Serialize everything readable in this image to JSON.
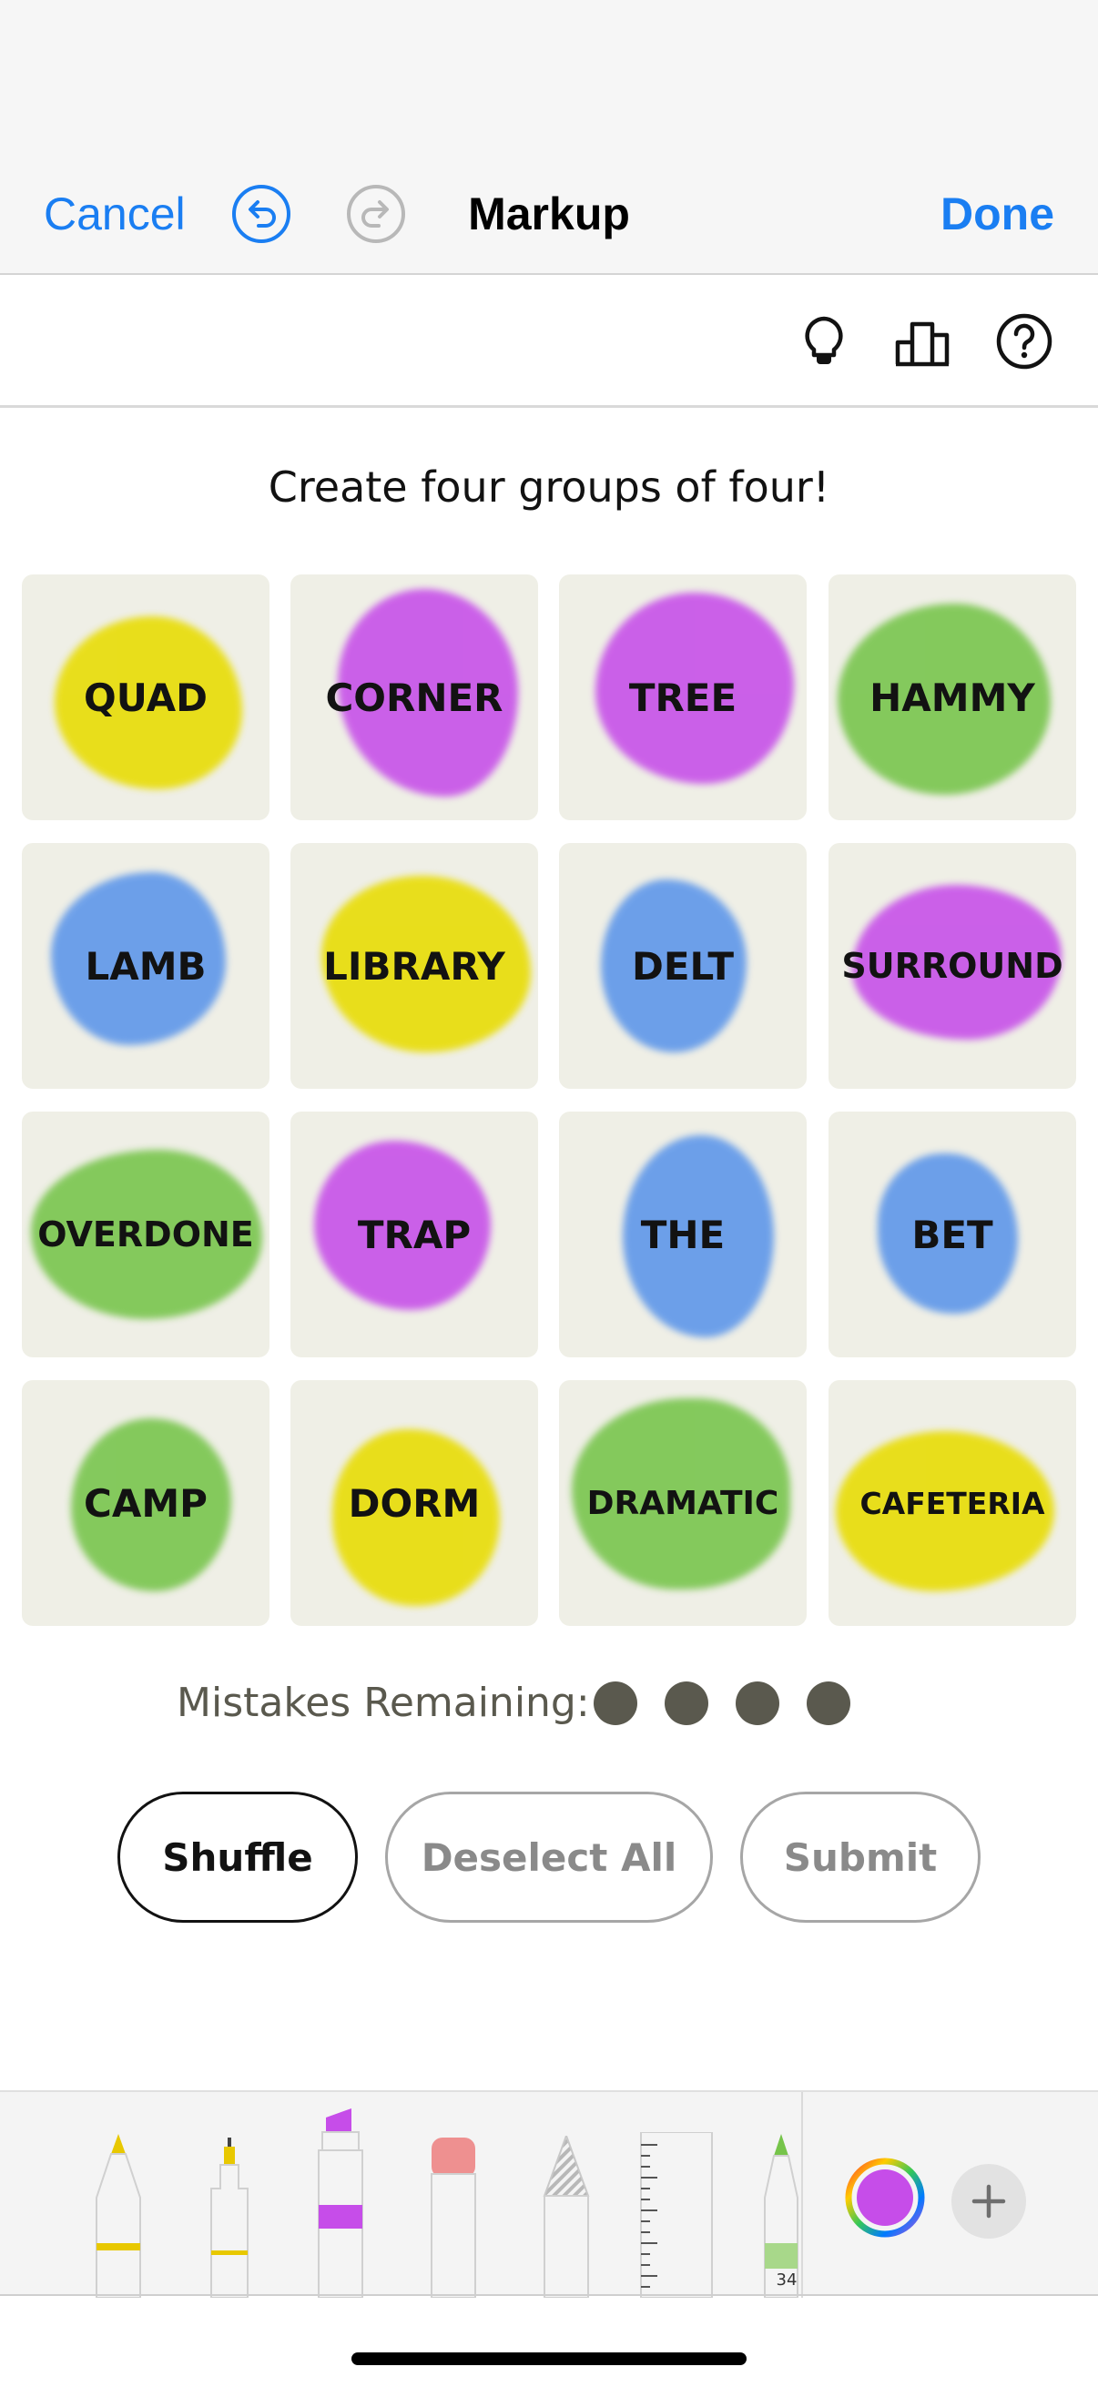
{
  "markup_bar": {
    "cancel_label": "Cancel",
    "title": "Markup",
    "done_label": "Done",
    "undo_icon": "undo-icon",
    "redo_icon": "redo-icon",
    "accent_color": "#1a7ef2"
  },
  "game_header": {
    "icons": [
      "hint-lightbulb-icon",
      "stats-podium-icon",
      "help-question-icon"
    ]
  },
  "instructions": "Create four groups of four!",
  "tiles": [
    {
      "word": "QUAD",
      "highlight": "#e8dc00"
    },
    {
      "word": "CORNER",
      "highlight": "#c64de9"
    },
    {
      "word": "TREE",
      "highlight": "#c64de9"
    },
    {
      "word": "HAMMY",
      "highlight": "#76c44a"
    },
    {
      "word": "LAMB",
      "highlight": "#5b95ea"
    },
    {
      "word": "LIBRARY",
      "highlight": "#e8dc00"
    },
    {
      "word": "DELT",
      "highlight": "#5b95ea"
    },
    {
      "word": "SURROUND",
      "highlight": "#c64de9"
    },
    {
      "word": "OVERDONE",
      "highlight": "#76c44a"
    },
    {
      "word": "TRAP",
      "highlight": "#c64de9"
    },
    {
      "word": "THE",
      "highlight": "#5b95ea"
    },
    {
      "word": "BET",
      "highlight": "#5b95ea"
    },
    {
      "word": "CAMP",
      "highlight": "#76c44a"
    },
    {
      "word": "DORM",
      "highlight": "#e8dc00"
    },
    {
      "word": "DRAMATIC",
      "highlight": "#76c44a"
    },
    {
      "word": "CAFETERIA",
      "highlight": "#e8dc00"
    }
  ],
  "mistakes": {
    "label": "Mistakes Remaining:",
    "remaining": 4,
    "dot_color": "#5a594e"
  },
  "buttons": {
    "shuffle_label": "Shuffle",
    "deselect_label": "Deselect All",
    "submit_label": "Submit"
  },
  "tools": {
    "items": [
      "pen-tool",
      "monoline-pen-tool",
      "highlighter-tool",
      "eraser-tool",
      "lasso-tool",
      "ruler-tool",
      "pencil-tool"
    ],
    "pencil_width_label": "34",
    "selected_color": "#c64de9",
    "add_icon": "plus-icon",
    "color_picker_icon": "color-wheel-icon"
  }
}
